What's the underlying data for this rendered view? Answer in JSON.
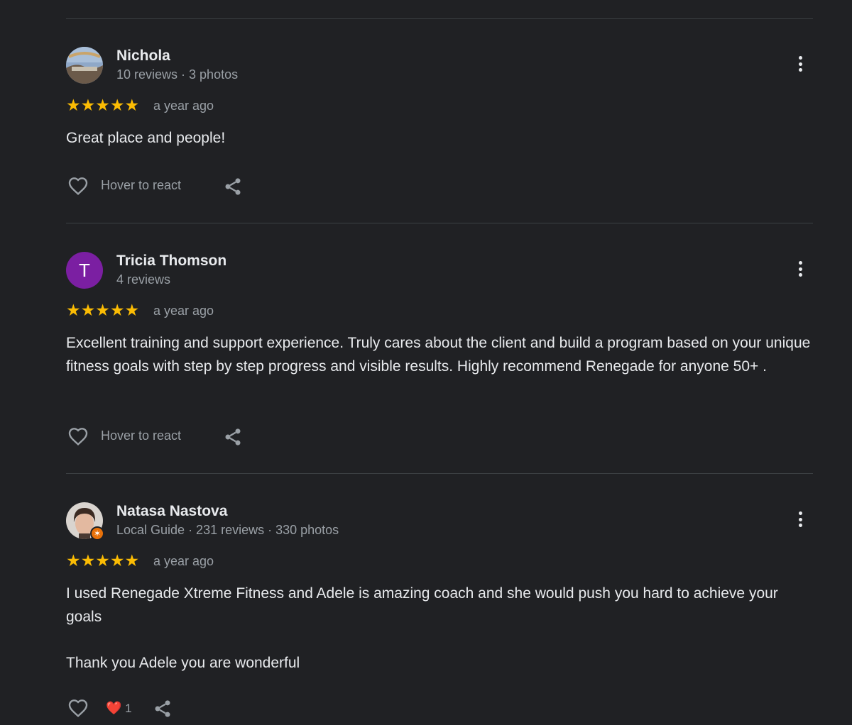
{
  "reviews": [
    {
      "name": "Nichola",
      "meta": "10 reviews · 3 photos",
      "stars": "★★★★★",
      "rating": 5,
      "date": "a year ago",
      "text": [
        "Great place and people!"
      ],
      "react_label": "Hover to react",
      "avatar": "photo"
    },
    {
      "name": "Tricia Thomson",
      "meta": "4 reviews",
      "avatar_letter": "T",
      "stars": "★★★★★",
      "rating": 5,
      "date": "a year ago",
      "text": [
        "Excellent training and support experience. Truly cares about the client and build a program based on your unique fitness goals with step by step progress and visible results. Highly recommend Renegade for anyone 50+ ."
      ],
      "react_label": "Hover to react"
    },
    {
      "name": "Natasa Nastova",
      "meta": "Local Guide · 231 reviews · 330 photos",
      "stars": "★★★★★",
      "rating": 5,
      "date": "a year ago",
      "text": [
        "I used Renegade Xtreme Fitness and Adele is amazing coach and she would push you hard to achieve your goals",
        "Thank you Adele you are wonderful"
      ],
      "reaction_heart": "❤️",
      "reaction_count": "1",
      "avatar": "photo"
    }
  ],
  "icons": {
    "more": "more-vert-icon",
    "heart": "heart-outline-icon",
    "share": "share-icon",
    "badge": "local-guide-badge-icon"
  },
  "colors": {
    "background": "#202124",
    "star": "#fbbc04",
    "avatar_purple": "#7b1fa2",
    "guide_badge": "#e8710a"
  }
}
